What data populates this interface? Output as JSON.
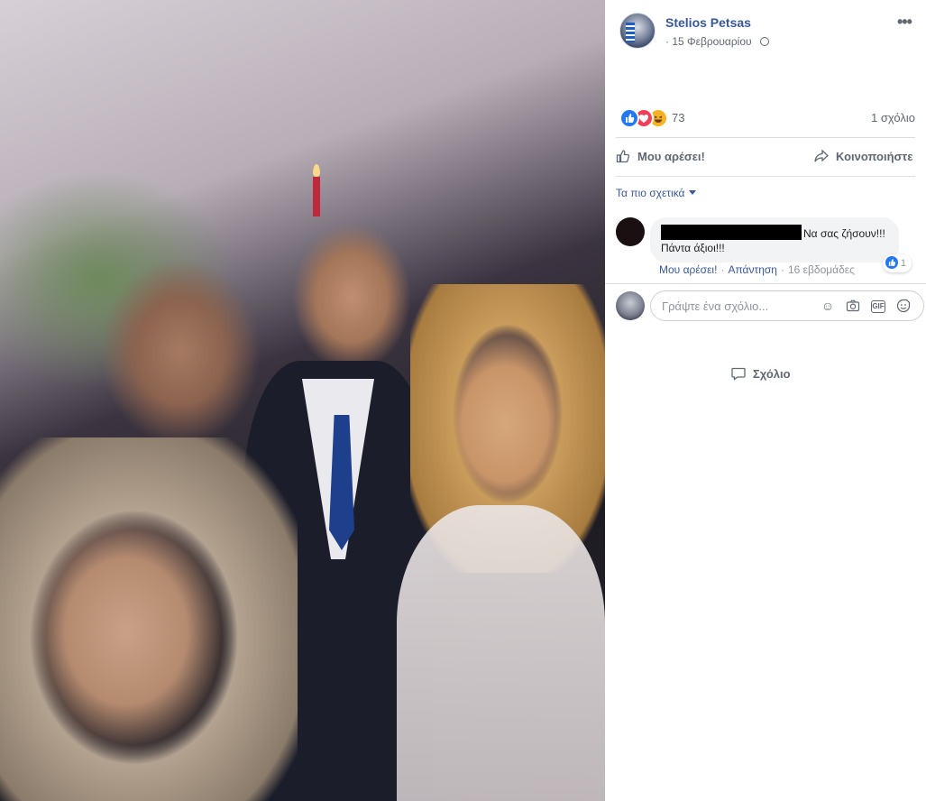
{
  "post": {
    "author": "Stelios Petsas",
    "date": "15 Φεβρουαρίου",
    "privacy_icon": "globe-icon",
    "more_label": "•••"
  },
  "reactions": {
    "count": "73",
    "types": [
      "like",
      "love",
      "haha"
    ],
    "comments_summary": "1 σχόλιο"
  },
  "actions": {
    "like": "Μου αρέσει!",
    "comment": "Σχόλιο",
    "share": "Κοινοποιήστε"
  },
  "comments_sort": "Τα πιο σχετικά",
  "comments": [
    {
      "text_line1": "Να σας ζήσουν!!!",
      "text_line2": "Πάντα άξιοι!!!",
      "like_action": "Μου αρέσει!",
      "reply_action": "Απάντηση",
      "time": "16 εβδομάδες",
      "reaction_count": "1"
    }
  ],
  "composer": {
    "placeholder": "Γράψτε ένα σχόλιο..."
  },
  "colors": {
    "link": "#385898",
    "like_blue": "#2078f4",
    "love_red": "#f33e58",
    "haha_yellow": "#f7b125"
  }
}
